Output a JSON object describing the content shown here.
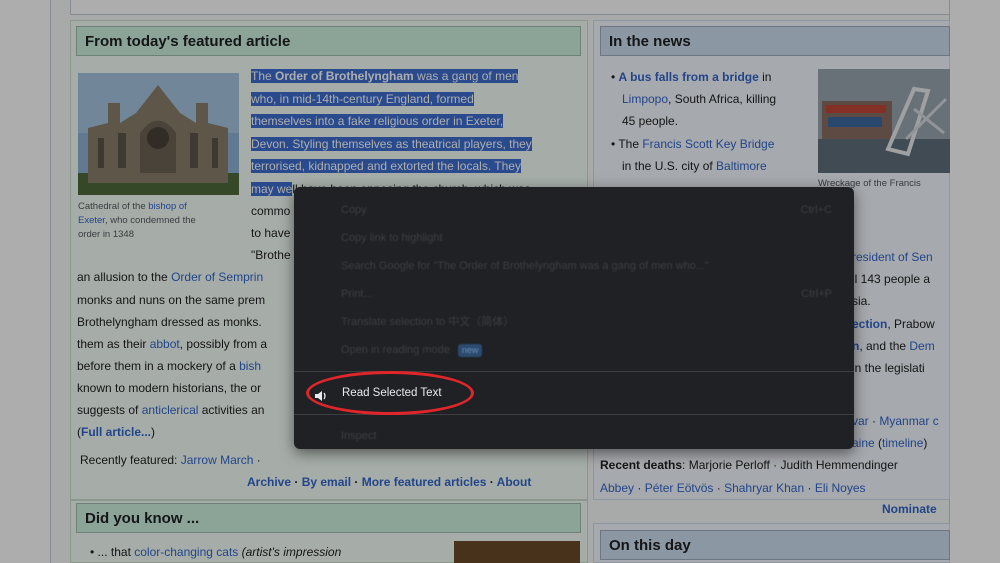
{
  "featured": {
    "heading": "From today's featured article",
    "caption": [
      "Cathedral of the ",
      "bishop of",
      "Exeter",
      ", who condemned the",
      "order in 1348"
    ],
    "selected_lines": [
      [
        "The ",
        "Order of Brothelyngham",
        " was a gang of men"
      ],
      "who, in mid-14th-century England, formed",
      "themselves into a fake religious order in Exeter,",
      "Devon. Styling themselves as theatrical players, they",
      "terrorised, kidnapped and extorted the locals. They",
      "may we"
    ],
    "line6_rest": "ll have been opposing the church, which was",
    "line7": "commo",
    "line8": "to have",
    "line9": "\"Brothe",
    "body": [
      [
        "an allusion to the ",
        "Order of Semprin",
        ""
      ],
      [
        "monks and nuns on the same prem",
        "",
        ""
      ],
      [
        "Brothelyngham dressed as monks.",
        "",
        ""
      ],
      [
        "them as their ",
        "abbot",
        ", possibly from a"
      ],
      [
        "before them in a mockery of a ",
        "bish",
        ""
      ],
      [
        "known to modern historians, the or",
        "",
        ""
      ],
      [
        "suggests of ",
        "anticlerical",
        " activities an"
      ]
    ],
    "full_article": "Full article...",
    "recently_featured": "Recently featured: ",
    "recent_link": "Jarrow March",
    "footer_links": [
      "Archive",
      "By email",
      "More featured articles",
      "About"
    ]
  },
  "news": {
    "heading": "In the news",
    "items": [
      [
        "A bus falls from a bridge",
        " in",
        "Limpopo",
        ", South Africa, killing",
        "45 people."
      ],
      [
        "The ",
        "Francis Scott Key Bridge",
        "in the U.S. city of ",
        "Baltimore"
      ]
    ],
    "img_caption": "Wreckage of the Francis",
    "right_bits": [
      "resident of Sen",
      "ll 143 people a",
      "sia.",
      "ection",
      ", Prabow",
      "n",
      ", and the ",
      "Dem",
      " in the legislati",
      "var",
      " · ",
      "Myanmar c",
      "aine",
      " (",
      "timeline",
      ")"
    ],
    "recent_deaths_label": "Recent deaths",
    "recent_deaths_line": ": Marjorie Perloff · Judith Hemmendinger",
    "deaths2": [
      "Abbey",
      "Péter Eötvös",
      "Shahryar Khan",
      "Eli Noyes"
    ],
    "nominate": "Nominate"
  },
  "dyk": {
    "heading": "Did you know ...",
    "item_pre": "... that ",
    "item_link": "color-changing cats",
    "item_post": " (artist's impression"
  },
  "otd": {
    "heading": "On this day"
  },
  "context_menu": {
    "items": [
      {
        "label": "Copy",
        "shortcut": "Ctrl+C"
      },
      {
        "label": "Copy link to highlight",
        "shortcut": ""
      },
      {
        "label": "Search Google for \"The Order of Brothelyngham was a gang of men who...\"",
        "shortcut": ""
      },
      {
        "label": "Print...",
        "shortcut": "Ctrl+P"
      },
      {
        "label": "Translate selection to 中文（简体）",
        "shortcut": ""
      },
      {
        "label": "Open in reading mode",
        "shortcut": "",
        "badge": "new"
      }
    ],
    "highlighted": "Read Selected Text",
    "inspect": "Inspect"
  },
  "colors": {
    "menu_bg": "#202124",
    "selection": "#3d6ecf",
    "ring": "#e0262b",
    "link": "#3366cc"
  }
}
